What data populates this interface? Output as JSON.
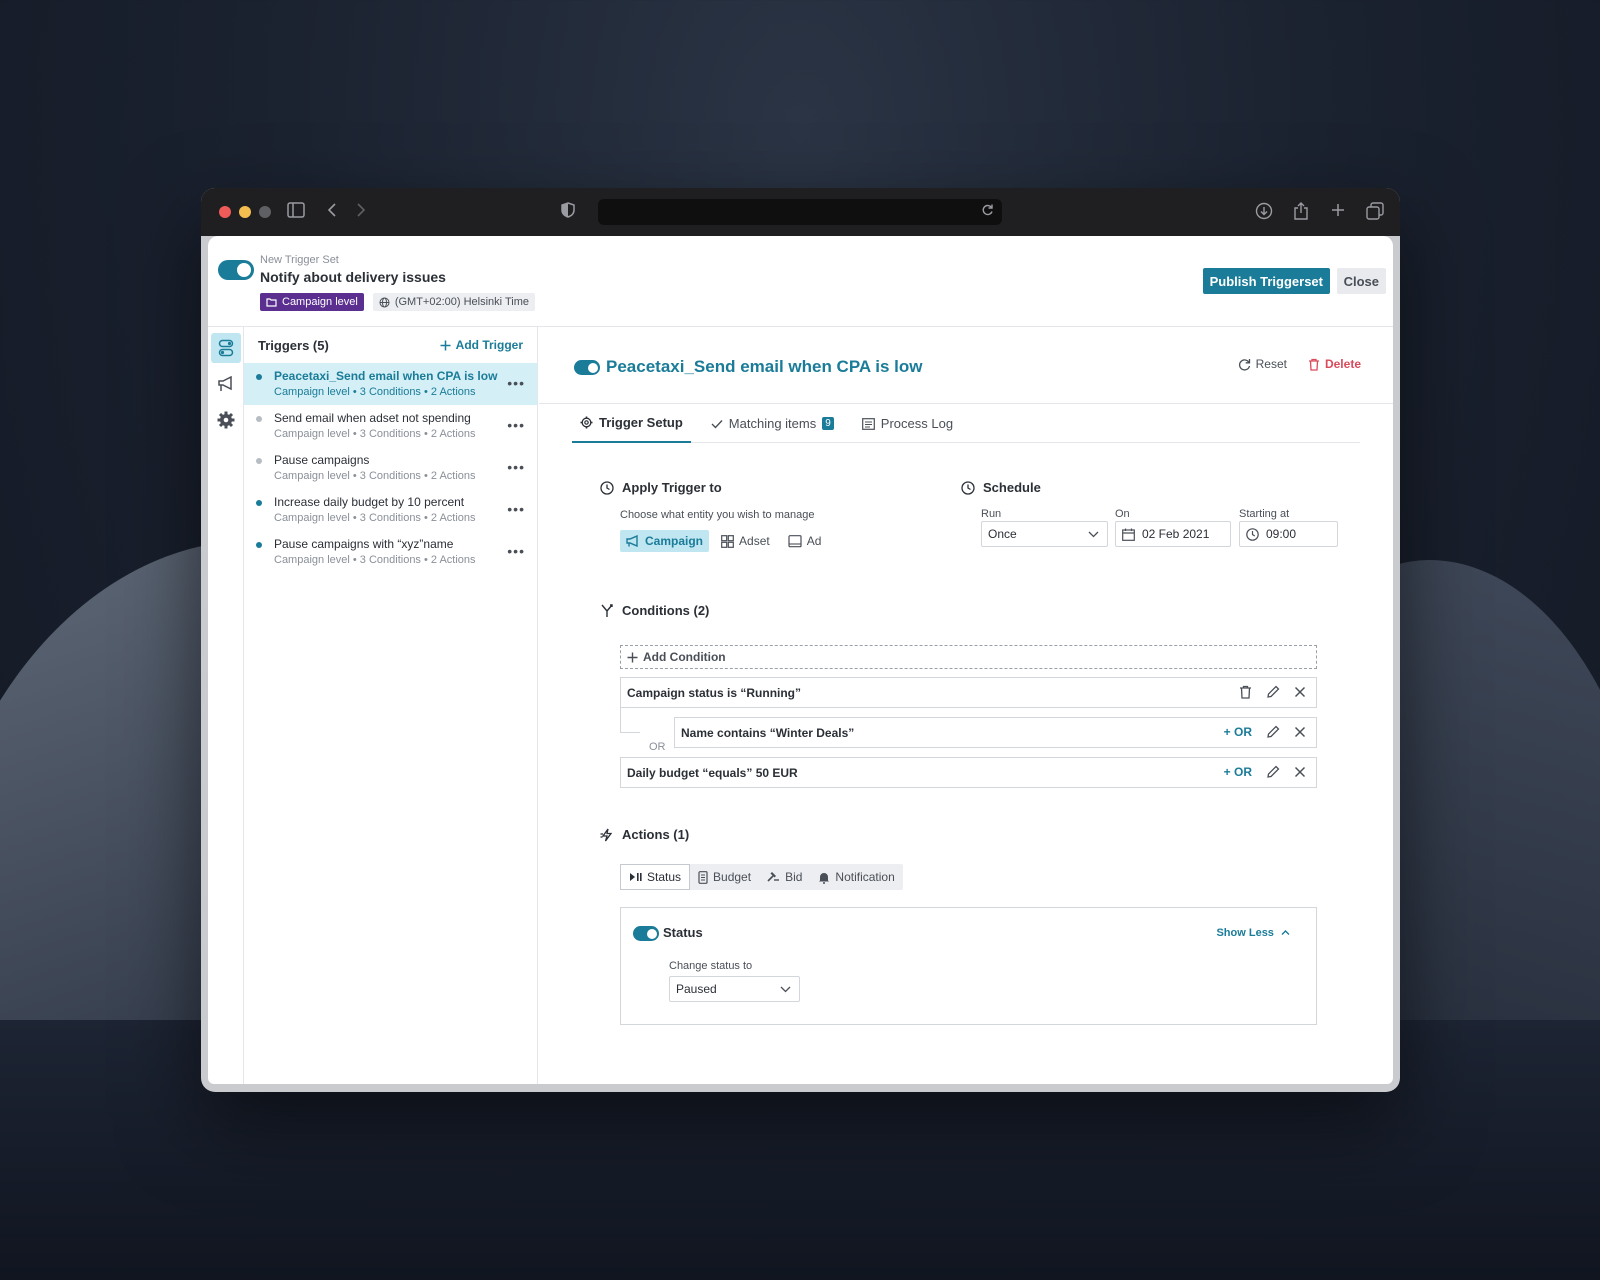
{
  "header": {
    "subtitle": "New Trigger Set",
    "title": "Notify about delivery issues",
    "level_chip": "Campaign level",
    "timezone_chip": "(GMT+02:00) Helsinki Time",
    "publish_label": "Publish Triggerset",
    "close_label": "Close"
  },
  "triggers": {
    "title": "Triggers (5)",
    "add_label": "Add Trigger",
    "items": [
      {
        "name": "Peacetaxi_Send email when CPA is low",
        "meta": "Campaign level • 3 Conditions • 2 Actions"
      },
      {
        "name": "Send email when adset not spending",
        "meta": "Campaign level • 3 Conditions • 2 Actions"
      },
      {
        "name": "Pause campaigns",
        "meta": "Campaign level • 3 Conditions • 2 Actions"
      },
      {
        "name": "Increase daily budget by 10 percent",
        "meta": "Campaign level • 3 Conditions • 2 Actions"
      },
      {
        "name": "Pause campaigns with “xyz”name",
        "meta": "Campaign level • 3 Conditions • 2 Actions"
      }
    ]
  },
  "main": {
    "title": "Peacetaxi_Send email when CPA is low",
    "reset_label": "Reset",
    "delete_label": "Delete",
    "tabs": [
      {
        "label": "Trigger Setup"
      },
      {
        "label": "Matching items",
        "badge": "9"
      },
      {
        "label": "Process Log"
      }
    ],
    "apply": {
      "title": "Apply Trigger to",
      "hint": "Choose what entity you wish to manage",
      "entities": [
        "Campaign",
        "Adset",
        "Ad"
      ]
    },
    "schedule": {
      "title": "Schedule",
      "run_label": "Run",
      "run_value": "Once",
      "on_label": "On",
      "on_value": "02 Feb 2021",
      "start_label": "Starting at",
      "start_value": "09:00"
    },
    "conditions": {
      "title": "Conditions (2)",
      "add_label": "Add Condition",
      "rows": [
        "Campaign status is “Running”",
        "Name contains “Winter Deals”",
        "Daily budget “equals” 50 EUR"
      ],
      "or_label": "OR",
      "or_button": "OR"
    },
    "actions": {
      "title": "Actions (1)",
      "tabs": [
        "Status",
        "Budget",
        "Bid",
        "Notification"
      ],
      "card_title": "Status",
      "show_less": "Show Less",
      "change_label": "Change status to",
      "status_value": "Paused"
    }
  },
  "colors": {
    "accent": "#1a7c99",
    "purple_chip": "#5a2f8f",
    "delete": "#d94a5b"
  }
}
